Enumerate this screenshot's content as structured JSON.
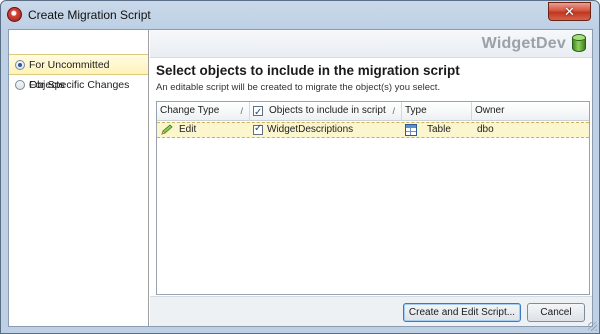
{
  "window": {
    "title": "Create Migration Script",
    "close_glyph": "✕"
  },
  "sidebar": {
    "items": [
      {
        "label": "For Uncommitted Objects",
        "selected": true
      },
      {
        "label": "For Specific Changes",
        "selected": false
      }
    ]
  },
  "header": {
    "brand": "WidgetDev",
    "brand_icon": "database-icon"
  },
  "main": {
    "title": "Select objects to include in the migration script",
    "subtitle": "An editable script will be created to migrate the object(s) you select."
  },
  "grid": {
    "columns": {
      "change_type": "Change Type",
      "objects": "Objects to include in script",
      "type": "Type",
      "owner": "Owner"
    },
    "sort_marks": {
      "change_type": "/",
      "objects": "/"
    },
    "header_checkbox_checked": true,
    "rows": [
      {
        "change_type": "Edit",
        "change_icon": "pencil-icon",
        "checked": true,
        "object": "WidgetDescriptions",
        "type": "Table",
        "type_icon": "table-icon",
        "owner": "dbo"
      }
    ]
  },
  "footer": {
    "primary_label": "Create and Edit Script...",
    "cancel_label": "Cancel"
  },
  "colors": {
    "selection_bg": "#fff3b8",
    "row_highlight": "#fcf6cf",
    "window_frame": "#bed0e4",
    "close_button": "#c0361f"
  }
}
